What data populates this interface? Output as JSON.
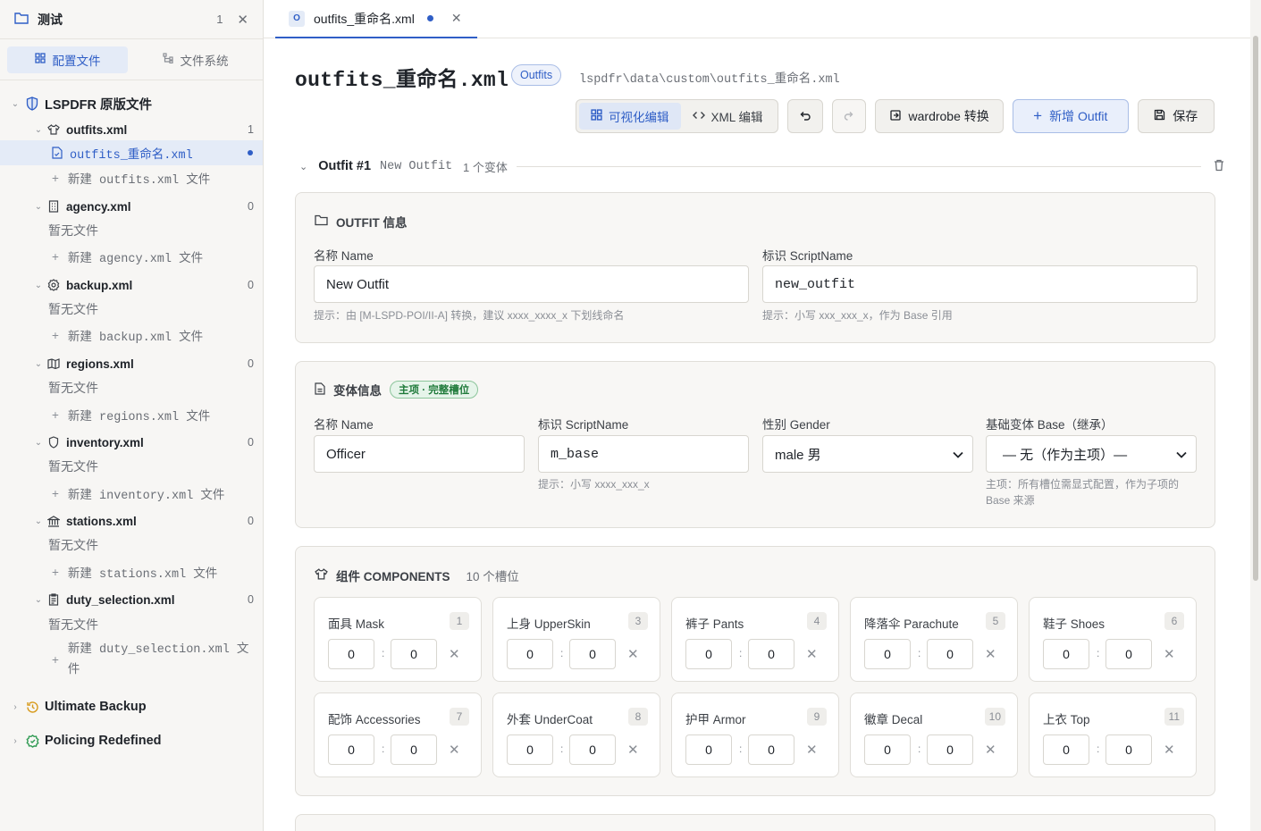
{
  "sidebar": {
    "workspace_title": "测试",
    "workspace_count": "1",
    "tabs": [
      {
        "label": "配置文件"
      },
      {
        "label": "文件系统"
      }
    ],
    "groups": {
      "lspdfr": "LSPDFR 原版文件",
      "ultimate": "Ultimate Backup",
      "policing": "Policing Redefined"
    },
    "files": [
      {
        "name": "outfits.xml",
        "count": "1",
        "icon": "shirt-icon",
        "new_label": "新建 outfits.xml 文件"
      },
      {
        "name": "agency.xml",
        "count": "0",
        "icon": "building-icon",
        "empty": "暂无文件",
        "new_label": "新建 agency.xml 文件"
      },
      {
        "name": "backup.xml",
        "count": "0",
        "icon": "badge-icon",
        "empty": "暂无文件",
        "new_label": "新建 backup.xml 文件"
      },
      {
        "name": "regions.xml",
        "count": "0",
        "icon": "map-icon",
        "empty": "暂无文件",
        "new_label": "新建 regions.xml 文件"
      },
      {
        "name": "inventory.xml",
        "count": "0",
        "icon": "shield-icon",
        "empty": "暂无文件",
        "new_label": "新建 inventory.xml 文件"
      },
      {
        "name": "stations.xml",
        "count": "0",
        "icon": "bank-icon",
        "empty": "暂无文件",
        "new_label": "新建 stations.xml 文件"
      },
      {
        "name": "duty_selection.xml",
        "count": "0",
        "icon": "clipboard-icon",
        "empty": "暂无文件",
        "new_label": "新建 duty_selection.xml 文",
        "new_label_2": "件"
      }
    ],
    "selected_file": "outfits_重命名.xml"
  },
  "tab": {
    "badge": "O",
    "label": "outfits_重命名.xml"
  },
  "header": {
    "title": "outfits_重命名.xml",
    "pill": "Outfits",
    "path": "lspdfr\\data\\custom\\outfits_重命名.xml"
  },
  "toolbar": {
    "visual_label": "可视化编辑",
    "xml_label": "XML 编辑",
    "wardrobe_label": "wardrobe 转换",
    "add_label": "新增 Outfit",
    "save_label": "保存"
  },
  "outfit": {
    "title": "Outfit #1",
    "name": "New Outfit",
    "variant_count": "1 个变体"
  },
  "outfit_info": {
    "heading": "OUTFIT 信息",
    "name_label": "名称 Name",
    "name_value": "New Outfit",
    "name_hint": "提示：由 [M-LSPD-POI/II-A] 转换，建议 xxxx_xxxx_x 下划线命名",
    "script_label": "标识 ScriptName",
    "script_value": "new_outfit",
    "script_hint": "提示：小写 xxx_xxx_x，作为 Base 引用"
  },
  "variant_info": {
    "heading": "变体信息",
    "tag": "主项 · 完整槽位",
    "name_label": "名称 Name",
    "name_value": "Officer",
    "script_label": "标识 ScriptName",
    "script_value": "m_base",
    "script_hint": "提示：小写 xxxx_xxx_x",
    "gender_label": "性别 Gender",
    "gender_value": "male 男",
    "base_label": "基础变体 Base（继承）",
    "base_value": "— 无（作为主项）—",
    "base_hint_1": "主项：所有槽位需显式配置，作为子项的",
    "base_hint_2": "Base 来源"
  },
  "components": {
    "heading": "组件 COMPONENTS",
    "slot_count": "10 个槽位",
    "items": [
      {
        "name": "面具 Mask",
        "id": "1",
        "a": "0",
        "b": "0"
      },
      {
        "name": "上身 UpperSkin",
        "id": "3",
        "a": "0",
        "b": "0"
      },
      {
        "name": "裤子 Pants",
        "id": "4",
        "a": "0",
        "b": "0"
      },
      {
        "name": "降落伞 Parachute",
        "id": "5",
        "a": "0",
        "b": "0"
      },
      {
        "name": "鞋子 Shoes",
        "id": "6",
        "a": "0",
        "b": "0"
      },
      {
        "name": "配饰 Accessories",
        "id": "7",
        "a": "0",
        "b": "0"
      },
      {
        "name": "外套 UnderCoat",
        "id": "8",
        "a": "0",
        "b": "0"
      },
      {
        "name": "护甲 Armor",
        "id": "9",
        "a": "0",
        "b": "0"
      },
      {
        "name": "徽章 Decal",
        "id": "10",
        "a": "0",
        "b": "0"
      },
      {
        "name": "上衣 Top",
        "id": "11",
        "a": "0",
        "b": "0"
      }
    ]
  },
  "colors": {
    "accent": "#2f5ec6",
    "success": "#1f7a3a"
  }
}
